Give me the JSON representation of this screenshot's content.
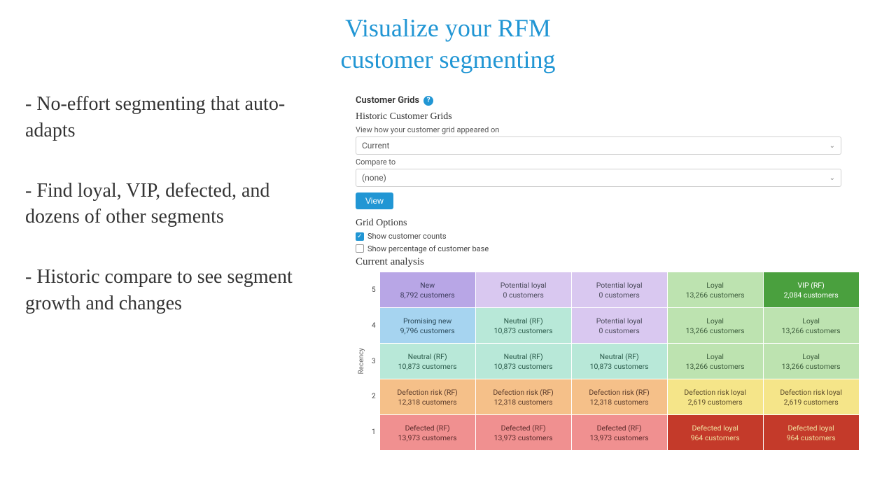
{
  "title_line1": "Visualize your RFM",
  "title_line2": "customer segmenting",
  "bullets": [
    "- No-effort segmenting that auto-adapts",
    "- Find loyal, VIP, defected, and dozens of other segments",
    "- Historic compare to see segment growth and changes"
  ],
  "panel": {
    "section_title": "Customer Grids",
    "historic_title": "Historic Customer Grids",
    "historic_desc": "View how your customer grid appeared on",
    "date_select_value": "Current",
    "compare_label": "Compare to",
    "compare_value": "(none)",
    "view_btn": "View",
    "grid_options_title": "Grid Options",
    "opt_counts": "Show customer counts",
    "opt_percent": "Show percentage of customer base",
    "analysis_title": "Current analysis",
    "y_axis": "Recency",
    "y_ticks": [
      "5",
      "4",
      "3",
      "2",
      "1"
    ],
    "customers_word": "customers",
    "cells": [
      [
        {
          "seg": "New",
          "count": "8,792",
          "bg": "#b8a6e6",
          "fg": "#3a3a5a"
        },
        {
          "seg": "Potential loyal",
          "count": "0",
          "bg": "#d9c8f0",
          "fg": "#4a4a5a"
        },
        {
          "seg": "Potential loyal",
          "count": "0",
          "bg": "#d9c8f0",
          "fg": "#4a4a5a"
        },
        {
          "seg": "Loyal",
          "count": "13,266",
          "bg": "#bde3b0",
          "fg": "#3a5a3a"
        },
        {
          "seg": "VIP (RF)",
          "count": "2,084",
          "bg": "#4aa03e",
          "fg": "#ffffff"
        }
      ],
      [
        {
          "seg": "Promising new",
          "count": "9,796",
          "bg": "#a6d4f0",
          "fg": "#2a4a5a"
        },
        {
          "seg": "Neutral (RF)",
          "count": "10,873",
          "bg": "#b8e8d8",
          "fg": "#2a5a4a"
        },
        {
          "seg": "Potential loyal",
          "count": "0",
          "bg": "#d9c8f0",
          "fg": "#4a4a5a"
        },
        {
          "seg": "Loyal",
          "count": "13,266",
          "bg": "#bde3b0",
          "fg": "#3a5a3a"
        },
        {
          "seg": "Loyal",
          "count": "13,266",
          "bg": "#bde3b0",
          "fg": "#3a5a3a"
        }
      ],
      [
        {
          "seg": "Neutral (RF)",
          "count": "10,873",
          "bg": "#b8e8d8",
          "fg": "#2a5a4a"
        },
        {
          "seg": "Neutral (RF)",
          "count": "10,873",
          "bg": "#b8e8d8",
          "fg": "#2a5a4a"
        },
        {
          "seg": "Neutral (RF)",
          "count": "10,873",
          "bg": "#b8e8d8",
          "fg": "#2a5a4a"
        },
        {
          "seg": "Loyal",
          "count": "13,266",
          "bg": "#bde3b0",
          "fg": "#3a5a3a"
        },
        {
          "seg": "Loyal",
          "count": "13,266",
          "bg": "#bde3b0",
          "fg": "#3a5a3a"
        }
      ],
      [
        {
          "seg": "Defection risk (RF)",
          "count": "12,318",
          "bg": "#f5c089",
          "fg": "#5a3a2a"
        },
        {
          "seg": "Defection risk (RF)",
          "count": "12,318",
          "bg": "#f5c089",
          "fg": "#5a3a2a"
        },
        {
          "seg": "Defection risk (RF)",
          "count": "12,318",
          "bg": "#f5c089",
          "fg": "#5a3a2a"
        },
        {
          "seg": "Defection risk loyal",
          "count": "2,619",
          "bg": "#f5e589",
          "fg": "#5a4a2a"
        },
        {
          "seg": "Defection risk loyal",
          "count": "2,619",
          "bg": "#f5e589",
          "fg": "#5a4a2a"
        }
      ],
      [
        {
          "seg": "Defected (RF)",
          "count": "13,973",
          "bg": "#f09090",
          "fg": "#5a2a2a"
        },
        {
          "seg": "Defected (RF)",
          "count": "13,973",
          "bg": "#f09090",
          "fg": "#5a2a2a"
        },
        {
          "seg": "Defected (RF)",
          "count": "13,973",
          "bg": "#f09090",
          "fg": "#5a2a2a"
        },
        {
          "seg": "Defected loyal",
          "count": "964",
          "bg": "#c43a2a",
          "fg": "#f0e0a0"
        },
        {
          "seg": "Defected loyal",
          "count": "964",
          "bg": "#c43a2a",
          "fg": "#f0e0a0"
        }
      ]
    ]
  }
}
